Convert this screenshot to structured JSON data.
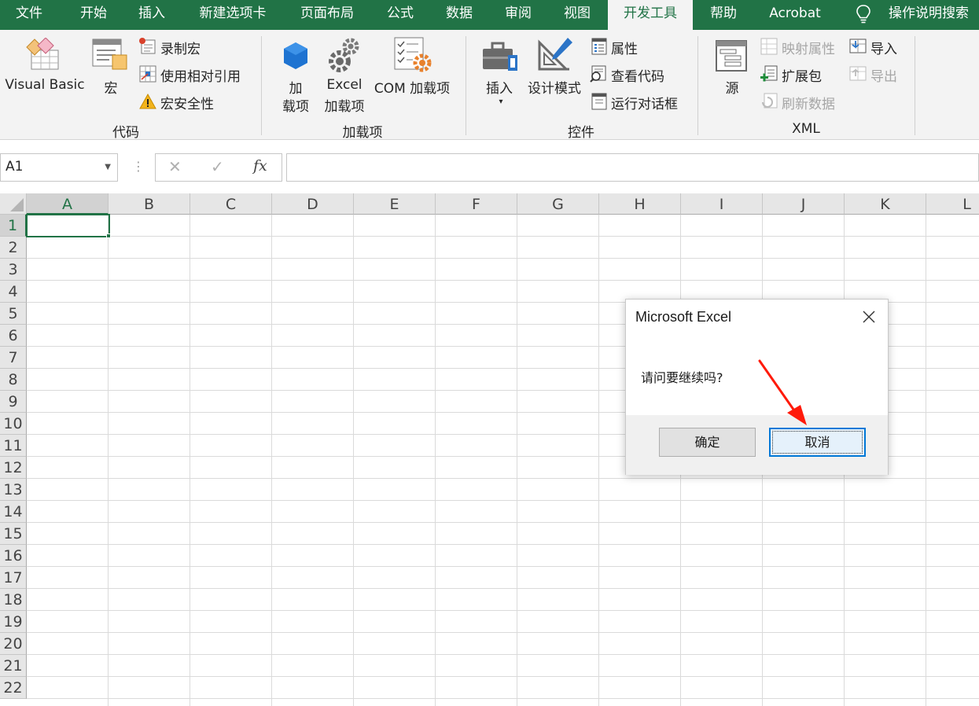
{
  "tabs": [
    {
      "label": "文件"
    },
    {
      "label": "开始"
    },
    {
      "label": "插入"
    },
    {
      "label": "新建选项卡"
    },
    {
      "label": "页面布局"
    },
    {
      "label": "公式"
    },
    {
      "label": "数据"
    },
    {
      "label": "审阅"
    },
    {
      "label": "视图"
    },
    {
      "label": "开发工具"
    },
    {
      "label": "帮助"
    },
    {
      "label": "Acrobat"
    },
    {
      "label": "操作说明搜索"
    }
  ],
  "ribbon": {
    "code": {
      "label": "代码",
      "visual_basic": "Visual Basic",
      "macros": "宏",
      "record_macro": "录制宏",
      "relative_ref": "使用相对引用",
      "macro_security": "宏安全性"
    },
    "addins": {
      "label": "加载项",
      "addins_line1": "加",
      "addins_line2": "载项",
      "excel_addins_line1": "Excel",
      "excel_addins_line2": "加载项",
      "com_addins": "COM 加载项"
    },
    "controls": {
      "label": "控件",
      "insert": "插入",
      "design_mode": "设计模式",
      "properties": "属性",
      "view_code": "查看代码",
      "run_dialog": "运行对话框"
    },
    "xml": {
      "label": "XML",
      "source": "源",
      "map_properties": "映射属性",
      "expansion_packs": "扩展包",
      "refresh_data": "刷新数据",
      "import": "导入",
      "export": "导出"
    }
  },
  "formula_bar": {
    "name_box": "A1",
    "cancel_glyph": "✕",
    "enter_glyph": "✓",
    "fx_glyph": "fx",
    "value": ""
  },
  "sheet": {
    "columns": [
      "A",
      "B",
      "C",
      "D",
      "E",
      "F",
      "G",
      "H",
      "I",
      "J",
      "K",
      "L"
    ],
    "rows": [
      "1",
      "2",
      "3",
      "4",
      "5",
      "6",
      "7",
      "8",
      "9",
      "10",
      "11",
      "12",
      "13",
      "14",
      "15",
      "16",
      "17",
      "18",
      "19",
      "20",
      "21",
      "22"
    ],
    "active_cell": "A1"
  },
  "dialog": {
    "title": "Microsoft Excel",
    "message": "请问要继续吗?",
    "ok_label": "确定",
    "cancel_label": "取消"
  },
  "colors": {
    "excel_green": "#217346",
    "ribbon_bg": "#f3f3f3",
    "annotation_arrow": "#ff1a0a",
    "focus_blue": "#0078d7"
  }
}
